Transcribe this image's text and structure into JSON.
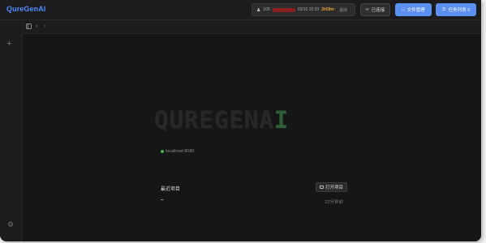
{
  "header": {
    "app_title": "QureGenAI",
    "user": {
      "icon": "user-icon",
      "id": "105",
      "datetime": "03/10 15:23",
      "timer": "2h59m",
      "logout_label": "退出"
    },
    "connected_label": "已连接",
    "files_label": "文件管理",
    "tasks_label": "任务列表 0"
  },
  "main": {
    "logo_main": "QUREGENA",
    "logo_accent": "I",
    "server_address": "localhost:8080",
    "recent_title": "最近项目",
    "open_project_label": "打开项目",
    "recent_projects": [
      {
        "name": "~",
        "time": "22分钟前"
      }
    ]
  },
  "colors": {
    "brand": "#4d8dff",
    "primary_button": "#5b8ff0",
    "status_ok": "#4caf50",
    "timer": "#e6a23c"
  }
}
